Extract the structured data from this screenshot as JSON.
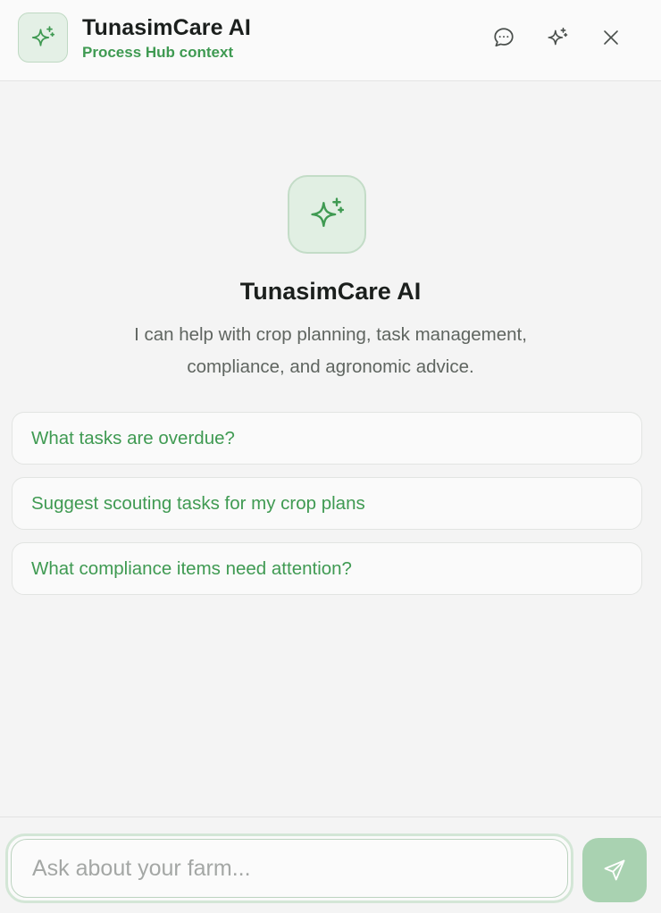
{
  "header": {
    "title": "TunasimCare AI",
    "subtitle": "Process Hub context",
    "logo_icon": "sparkles-icon",
    "actions": [
      {
        "name": "chat-history-button",
        "icon": "chat-bubble-icon"
      },
      {
        "name": "ai-mode-button",
        "icon": "sparkles-icon"
      },
      {
        "name": "close-button",
        "icon": "close-icon"
      }
    ]
  },
  "hero": {
    "icon": "sparkles-icon",
    "title": "TunasimCare AI",
    "description": "I can help with crop planning, task management, compliance, and agronomic advice."
  },
  "suggestions": [
    "What tasks are overdue?",
    "Suggest scouting tasks for my crop plans",
    "What compliance items need attention?"
  ],
  "composer": {
    "placeholder": "Ask about your farm...",
    "value": "",
    "send_icon": "send-icon"
  },
  "colors": {
    "accent": "#3f9a52",
    "accent_light": "#e1efe3",
    "send_button": "#a9d2b1",
    "background": "#f4f4f4"
  }
}
